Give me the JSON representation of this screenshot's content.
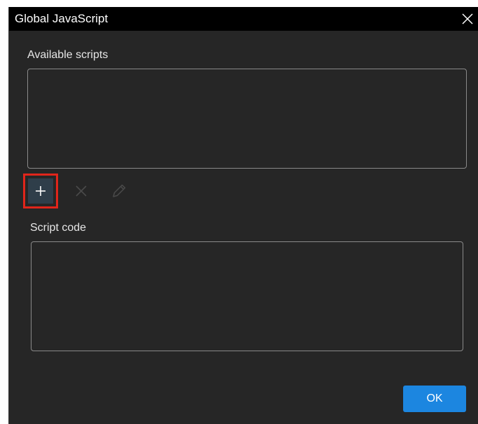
{
  "dialog": {
    "title": "Global JavaScript",
    "close_icon": "close-icon"
  },
  "available_scripts": {
    "label": "Available scripts",
    "items": []
  },
  "toolbar": {
    "add_icon": "plus-icon",
    "remove_icon": "x-icon",
    "edit_icon": "pencil-icon"
  },
  "script_code": {
    "label": "Script code",
    "value": ""
  },
  "footer": {
    "ok_label": "OK"
  },
  "colors": {
    "dialog_bg": "#262626",
    "titlebar_bg": "#000000",
    "accent": "#1c86e0",
    "highlight": "#e0251b",
    "disabled_icon": "#4a4a4a"
  }
}
